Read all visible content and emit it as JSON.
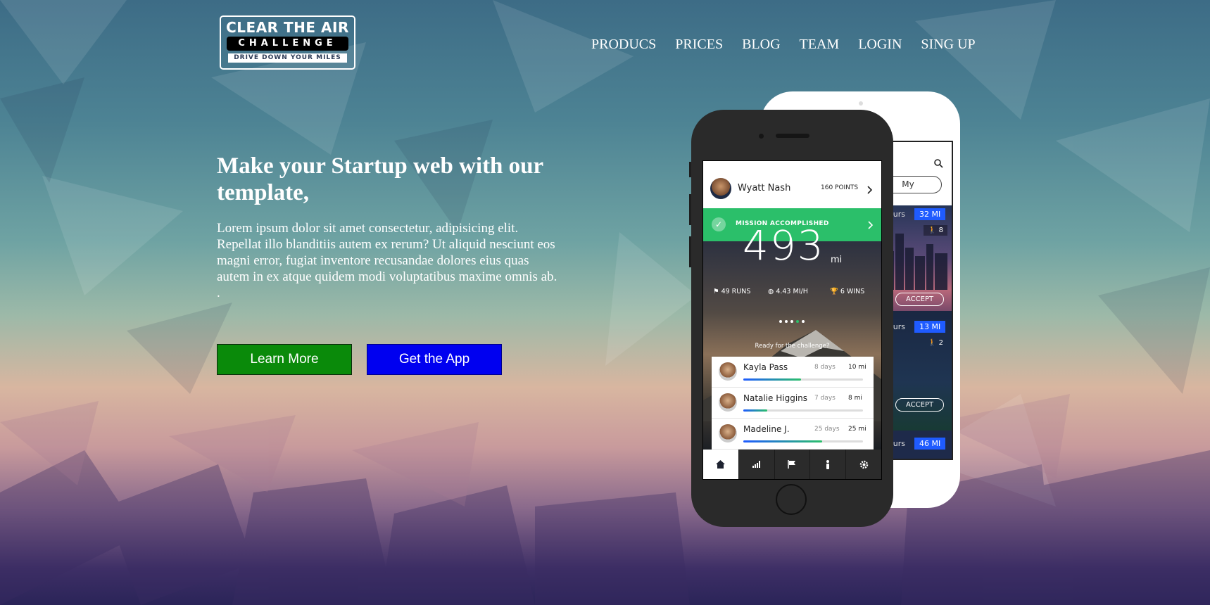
{
  "logo": {
    "line1": "CLEAR THE AIR",
    "line2": "CHALLENGE",
    "line3": "DRIVE DOWN YOUR MILES"
  },
  "nav": [
    "PRODUCS",
    "PRICES",
    "BLOG",
    "TEAM",
    "LOGIN",
    "SING UP"
  ],
  "hero": {
    "headline": "Make your Startup web with our template,",
    "lead": "Lorem ipsum dolor sit amet consectetur, adipisicing elit. Repellat illo blanditiis autem ex rerum? Ut aliquid nesciunt eos magni error, fugiat inventore recusandae dolores eius quas autem in ex atque quidem modi voluptatibus maxime omnis ab. .",
    "learn_more": "Learn More",
    "get_app": "Get the App"
  },
  "front_phone": {
    "user": "Wyatt Nash",
    "points": "160 POINTS",
    "mission": "MISSION ACCOMPLISHED",
    "distance": "493",
    "distance_unit": "mi",
    "stats": [
      {
        "icon": "flag-icon",
        "label": "49 RUNS"
      },
      {
        "icon": "speedometer-icon",
        "label": "4.43 MI/H"
      },
      {
        "icon": "trophy-icon",
        "label": "6 WINS"
      }
    ],
    "challenge_prompt": "Ready for the challenge?",
    "leaders": [
      {
        "name": "Kayla Pass",
        "days": "8 days",
        "miles": "10 mi",
        "progress": 0.48,
        "color": "#2bbf6a"
      },
      {
        "name": "Natalie Higgins",
        "days": "7 days",
        "miles": "8 mi",
        "progress": 0.2,
        "color": "#2bbf6a"
      },
      {
        "name": "Madeline J.",
        "days": "25 days",
        "miles": "25 mi",
        "progress": 0.66,
        "color": "#2bbf6a"
      }
    ],
    "tabs": [
      "home-icon",
      "stats-icon",
      "flag-icon",
      "person-icon",
      "gear-icon"
    ]
  },
  "back_phone": {
    "tab_my": "My",
    "cards": [
      {
        "hours": "ours",
        "miles": "32 MI",
        "people": "8",
        "accept": "ACCEPT"
      },
      {
        "hours": "ours",
        "miles": "13 MI",
        "people": "2",
        "accept": "ACCEPT"
      },
      {
        "hours": "ours",
        "miles": "46 MI"
      }
    ]
  },
  "colors": {
    "green_button": "#0a8a0a",
    "blue_button": "#0000f0",
    "mission_green": "#2bbf6a",
    "badge_blue": "#1f5bff"
  }
}
